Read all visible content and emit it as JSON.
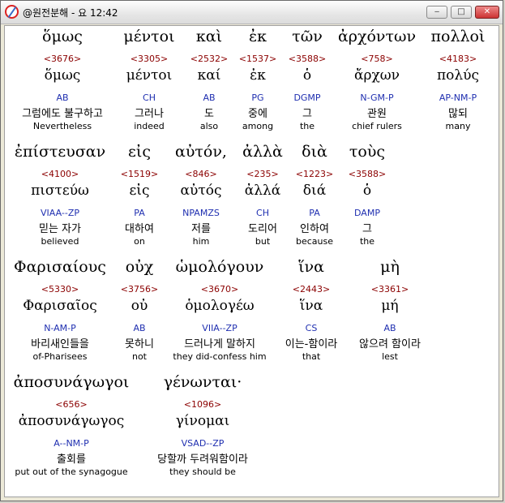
{
  "window": {
    "title": "@원전분해 - 요 12:42",
    "controls": {
      "minimize": "‒",
      "maximize": "□",
      "close": "✕"
    }
  },
  "rows": [
    {
      "words": [
        {
          "greek": "ὅμως",
          "strong": "<3676>",
          "lemma": "ὅμως",
          "parse": "AB",
          "korean": "그럼에도 불구하고",
          "english": "Nevertheless"
        },
        {
          "greek": "μέντοι",
          "strong": "<3305>",
          "lemma": "μέντοι",
          "parse": "CH",
          "korean": "그러나",
          "english": "indeed"
        },
        {
          "greek": "καὶ",
          "strong": "<2532>",
          "lemma": "καί",
          "parse": "AB",
          "korean": "도",
          "english": "also"
        },
        {
          "greek": "ἐκ",
          "strong": "<1537>",
          "lemma": "ἐκ",
          "parse": "PG",
          "korean": "중에",
          "english": "among"
        },
        {
          "greek": "τῶν",
          "strong": "<3588>",
          "lemma": "ὁ",
          "parse": "DGMP",
          "korean": "그",
          "english": "the"
        },
        {
          "greek": "ἀρχόντων",
          "strong": "<758>",
          "lemma": "ἄρχων",
          "parse": "N-GM-P",
          "korean": "관원",
          "english": "chief rulers"
        },
        {
          "greek": "πολλοὶ",
          "strong": "<4183>",
          "lemma": "πολύς",
          "parse": "AP-NM-P",
          "korean": "많되",
          "english": "many"
        }
      ]
    },
    {
      "words": [
        {
          "greek": "ἐπίστευσαν",
          "strong": "<4100>",
          "lemma": "πιστεύω",
          "parse": "VIAA--ZP",
          "korean": "믿는 자가",
          "english": "believed"
        },
        {
          "greek": "εἰς",
          "strong": "<1519>",
          "lemma": "εἰς",
          "parse": "PA",
          "korean": "대하여",
          "english": "on"
        },
        {
          "greek": "αὐτόν,",
          "strong": "<846>",
          "lemma": "αὐτός",
          "parse": "NPAMZS",
          "korean": "저를",
          "english": "him"
        },
        {
          "greek": "ἀλλὰ",
          "strong": "<235>",
          "lemma": "ἀλλά",
          "parse": "CH",
          "korean": "도리어",
          "english": "but"
        },
        {
          "greek": "διὰ",
          "strong": "<1223>",
          "lemma": "διά",
          "parse": "PA",
          "korean": "인하여",
          "english": "because"
        },
        {
          "greek": "τοὺς",
          "strong": "<3588>",
          "lemma": "ὁ",
          "parse": "DAMP",
          "korean": "그",
          "english": "the"
        }
      ]
    },
    {
      "words": [
        {
          "greek": "Φαρισαίους",
          "strong": "<5330>",
          "lemma": "Φαρισαῖος",
          "parse": "N-AM-P",
          "korean": "바리새인들을",
          "english": "of-Pharisees"
        },
        {
          "greek": "οὐχ",
          "strong": "<3756>",
          "lemma": "οὐ",
          "parse": "AB",
          "korean": "못하니",
          "english": "not"
        },
        {
          "greek": "ὡμολόγουν",
          "strong": "<3670>",
          "lemma": "ὁμολογέω",
          "parse": "VIIA--ZP",
          "korean": "드러나게 말하지",
          "english": "they did-confess him"
        },
        {
          "greek": "ἵνα",
          "strong": "<2443>",
          "lemma": "ἵνα",
          "parse": "CS",
          "korean": "이는-함이라",
          "english": "that"
        },
        {
          "greek": "μὴ",
          "strong": "<3361>",
          "lemma": "μή",
          "parse": "AB",
          "korean": "않으려 함이라",
          "english": "lest"
        }
      ]
    },
    {
      "words": [
        {
          "greek": "ἀποσυνάγωγοι",
          "strong": "<656>",
          "lemma": "ἀποσυνάγωγος",
          "parse": "A--NM-P",
          "korean": "출회를",
          "english": "put out of the synagogue"
        },
        {
          "greek": "γένωνται·",
          "strong": "<1096>",
          "lemma": "γίνομαι",
          "parse": "VSAD--ZP",
          "korean": "당할까 두려워함이라",
          "english": "they should be"
        }
      ]
    }
  ]
}
